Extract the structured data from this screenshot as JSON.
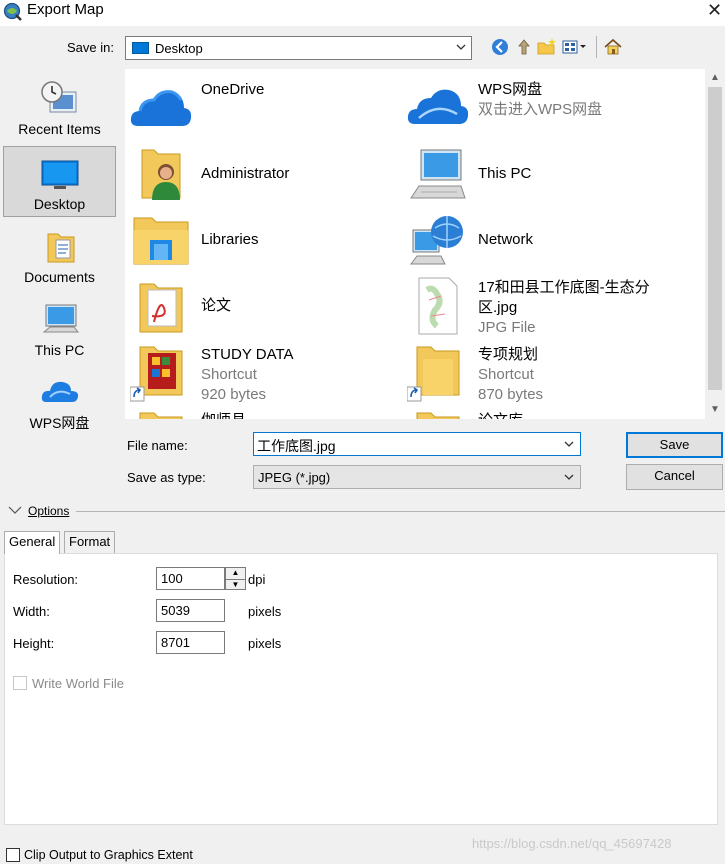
{
  "window": {
    "title": "Export Map"
  },
  "save_in": {
    "label": "Save in:",
    "value": "Desktop"
  },
  "places": [
    {
      "label": "Recent Items",
      "icon": "recent-items-icon"
    },
    {
      "label": "Desktop",
      "icon": "desktop-icon",
      "selected": true
    },
    {
      "label": "Documents",
      "icon": "documents-icon"
    },
    {
      "label": "This PC",
      "icon": "this-pc-icon"
    },
    {
      "label": "WPS网盘",
      "icon": "wps-cloud-icon"
    }
  ],
  "files": [
    {
      "name": "OneDrive",
      "icon": "onedrive-icon"
    },
    {
      "name": "WPS网盘",
      "sub": "双击进入WPS网盘",
      "icon": "wps-cloud-icon"
    },
    {
      "name": "Administrator",
      "icon": "user-folder-icon"
    },
    {
      "name": "This PC",
      "icon": "this-pc-icon"
    },
    {
      "name": "Libraries",
      "icon": "libraries-icon"
    },
    {
      "name": "Network",
      "icon": "network-icon"
    },
    {
      "name": "论文",
      "icon": "pdf-folder-icon"
    },
    {
      "name": "17和田县工作底图-生态分",
      "name2": "区.jpg",
      "sub": "JPG File",
      "icon": "jpg-file-icon"
    },
    {
      "name": "STUDY DATA",
      "sub": "Shortcut",
      "sub2": "920 bytes",
      "icon": "shortcut-folder-icon"
    },
    {
      "name": "专项规划",
      "sub": "Shortcut",
      "sub2": "870 bytes",
      "icon": "shortcut-folder-icon"
    },
    {
      "name": "伽师县",
      "icon": "folder-icon"
    },
    {
      "name": "论文库",
      "icon": "folder-icon"
    }
  ],
  "file_name": {
    "label": "File name:",
    "value": "工作底图.jpg"
  },
  "save_as_type": {
    "label": "Save as type:",
    "value": "JPEG (*.jpg)"
  },
  "buttons": {
    "save": "Save",
    "cancel": "Cancel"
  },
  "options": {
    "label": "Options",
    "tabs": [
      "General",
      "Format"
    ],
    "resolution": {
      "label": "Resolution:",
      "value": "100",
      "unit": "dpi"
    },
    "width": {
      "label": "Width:",
      "value": "5039",
      "unit": "pixels"
    },
    "height": {
      "label": "Height:",
      "value": "8701",
      "unit": "pixels"
    },
    "write_world_file": {
      "label": "Write World File",
      "checked": false,
      "enabled": false
    }
  },
  "clip_output": {
    "label": "Clip Output to Graphics Extent",
    "checked": false
  },
  "watermark": "https://blog.csdn.net/qq_45697428",
  "colors": {
    "accent": "#0078d7",
    "window_bg": "#f0f0f0"
  }
}
